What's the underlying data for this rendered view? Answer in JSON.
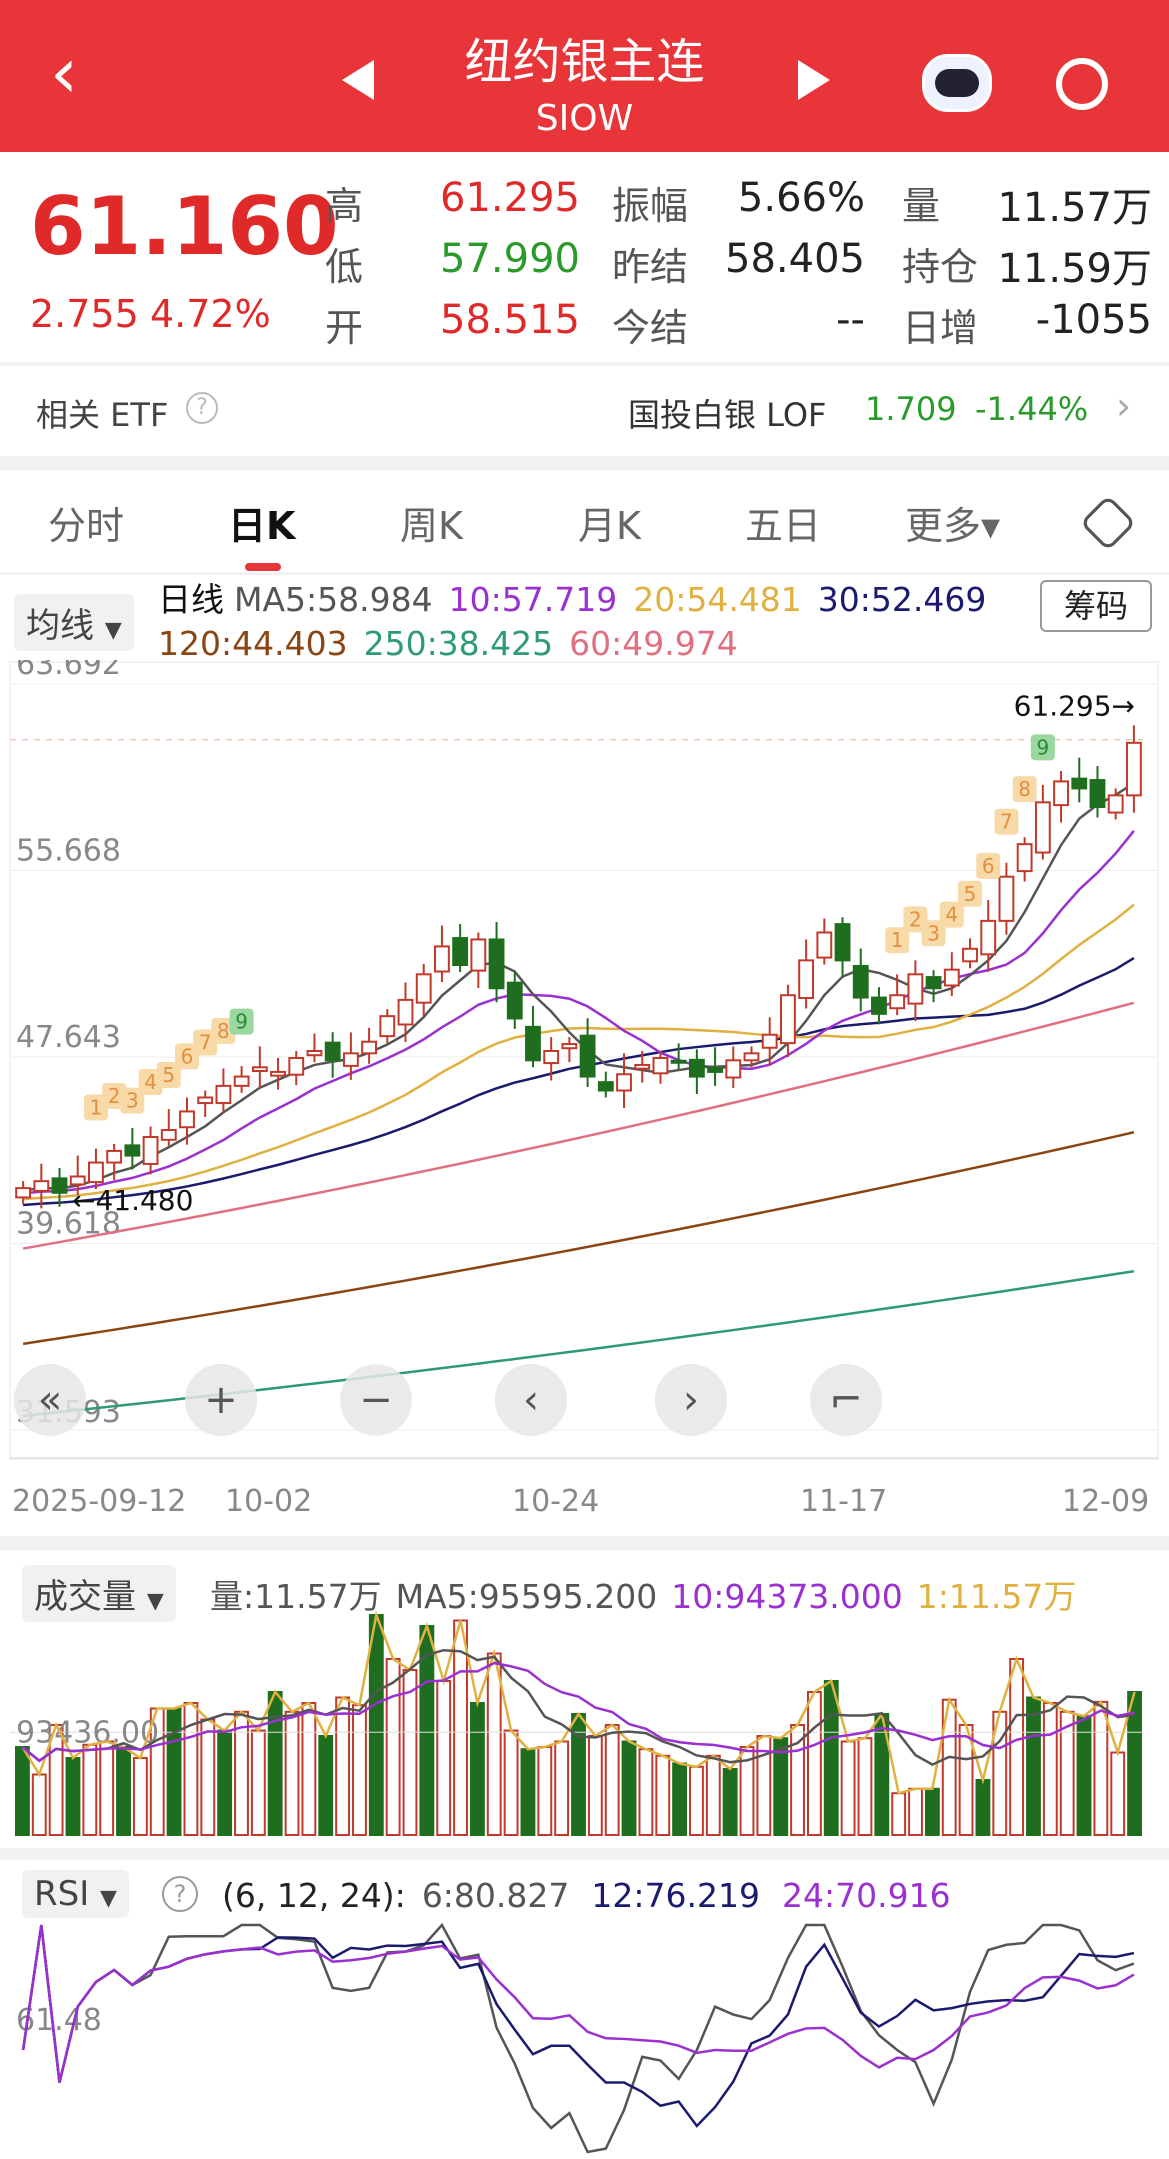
{
  "header": {
    "title": "纽约银主连",
    "subtitle": "SIOW"
  },
  "quote": {
    "price": "61.160",
    "change": "2.755",
    "change_pct": "4.72%",
    "rows": [
      {
        "l1": "高",
        "v1": "61.295",
        "c1": "red",
        "l2": "振幅",
        "v2": "5.66%",
        "l3": "量",
        "v3": "11.57万"
      },
      {
        "l1": "低",
        "v1": "57.990",
        "c1": "green",
        "l2": "昨结",
        "v2": "58.405",
        "l3": "持仓",
        "v3": "11.59万"
      },
      {
        "l1": "开",
        "v1": "58.515",
        "c1": "red",
        "l2": "今结",
        "v2": "--",
        "l3": "日增",
        "v3": "-1055"
      }
    ]
  },
  "etf": {
    "label": "相关 ETF",
    "name": "国投白银 LOF",
    "price": "1.709",
    "pct": "-1.44%"
  },
  "tabs": [
    "分时",
    "日K",
    "周K",
    "月K",
    "五日",
    "更多▾"
  ],
  "active_tab": 1,
  "ma_legend": {
    "selector": "均线",
    "period": "日线",
    "chip": "筹码",
    "items": [
      {
        "t": "MA5:58.984",
        "c": "#555555"
      },
      {
        "t": "10:57.719",
        "c": "#9b30d0"
      },
      {
        "t": "20:54.481",
        "c": "#e0b040"
      },
      {
        "t": "30:52.469",
        "c": "#1a1a6e"
      },
      {
        "t": "120:44.403",
        "c": "#8b4513"
      },
      {
        "t": "250:38.425",
        "c": "#2e9a77"
      },
      {
        "t": "60:49.974",
        "c": "#e07080"
      }
    ]
  },
  "price_axis": [
    "63.692",
    "55.668",
    "47.643",
    "39.618",
    "31.593"
  ],
  "high_marker": "61.295→",
  "low_marker": "←41.480",
  "dates": [
    "2025-09-12",
    "10-02",
    "10-24",
    "11-17",
    "12-09"
  ],
  "closes": [
    42.0,
    42.3,
    41.8,
    42.5,
    43.1,
    43.6,
    43.4,
    44.2,
    44.5,
    45.3,
    45.9,
    46.4,
    46.8,
    47.2,
    47.0,
    47.6,
    47.9,
    47.5,
    47.8,
    48.3,
    49.4,
    50.1,
    51.2,
    52.4,
    51.6,
    52.7,
    50.6,
    49.3,
    47.5,
    47.9,
    48.2,
    46.8,
    46.2,
    46.9,
    47.3,
    47.6,
    47.4,
    46.8,
    47.0,
    47.5,
    47.8,
    48.6,
    50.3,
    51.8,
    53.0,
    51.8,
    50.2,
    49.5,
    50.3,
    51.2,
    50.6,
    51.4,
    52.3,
    53.5,
    55.4,
    56.8,
    58.6,
    59.5,
    59.2,
    58.4,
    58.9,
    61.16
  ],
  "long_ma": [
    {
      "name": "MA60",
      "from": 39.4,
      "to": 49.974,
      "c": "#e07080"
    },
    {
      "name": "MA120",
      "from": 35.3,
      "to": 44.403,
      "c": "#8b4513"
    },
    {
      "name": "MA250",
      "from": 32.2,
      "to": 38.425,
      "c": "#2e9a77"
    }
  ],
  "seq_labels": [
    {
      "i": 4,
      "t": "1"
    },
    {
      "i": 5,
      "t": "2"
    },
    {
      "i": 6,
      "t": "3"
    },
    {
      "i": 7,
      "t": "4"
    },
    {
      "i": 8,
      "t": "5"
    },
    {
      "i": 9,
      "t": "6"
    },
    {
      "i": 10,
      "t": "7"
    },
    {
      "i": 11,
      "t": "8"
    },
    {
      "i": 12,
      "t": "9"
    },
    {
      "i": 48,
      "t": "1"
    },
    {
      "i": 49,
      "t": "2"
    },
    {
      "i": 50,
      "t": "3"
    },
    {
      "i": 51,
      "t": "4"
    },
    {
      "i": 52,
      "t": "5"
    },
    {
      "i": 53,
      "t": "6"
    },
    {
      "i": 54,
      "t": "7"
    },
    {
      "i": 55,
      "t": "8"
    },
    {
      "i": 56,
      "t": "9"
    }
  ],
  "volume": {
    "selector": "成交量",
    "legend": [
      {
        "t": "量:11.57万",
        "c": "#555555"
      },
      {
        "t": "MA5:95595.200",
        "c": "#555555"
      },
      {
        "t": "10:94373.000",
        "c": "#9b30d0"
      },
      {
        "t": "1:11.57万",
        "c": "#e0b040"
      }
    ],
    "axis_label": "93436.00",
    "values": [
      80,
      55,
      100,
      70,
      82,
      85,
      80,
      70,
      115,
      115,
      120,
      105,
      95,
      112,
      95,
      130,
      112,
      120,
      90,
      125,
      118,
      200,
      160,
      150,
      190,
      140,
      195,
      120,
      165,
      95,
      78,
      80,
      85,
      110,
      90,
      100,
      85,
      78,
      72,
      65,
      62,
      72,
      60,
      80,
      90,
      88,
      100,
      130,
      140,
      85,
      88,
      110,
      38,
      42,
      42,
      123,
      100,
      50,
      112,
      160,
      125,
      120,
      112,
      108,
      121,
      75,
      130
    ]
  },
  "rsi": {
    "selector": "RSI",
    "params": "(6, 12, 24):",
    "legend": [
      {
        "t": "6:80.827",
        "c": "#555555"
      },
      {
        "t": "12:76.219",
        "c": "#1a1a6e"
      },
      {
        "t": "24:70.916",
        "c": "#9b30d0"
      }
    ],
    "axis_label": "61.48"
  },
  "nav_icons": [
    "«",
    "+",
    "−",
    "‹",
    "›",
    "⌐"
  ]
}
